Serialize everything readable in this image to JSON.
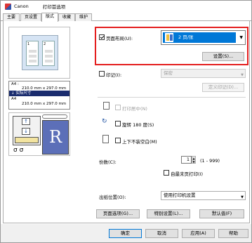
{
  "window": {
    "brand": "Canon",
    "title": "打印首选项"
  },
  "tabs": [
    "主要",
    "页设置",
    "版式",
    "收藏",
    "维护"
  ],
  "active_tab": "版式",
  "page_layout": {
    "checkbox_label": "页面布局(U):",
    "checked": true,
    "selected": "2 页/张",
    "settings_button": "设置(S)..."
  },
  "stamp": {
    "checkbox_label": "印记(I):",
    "checked": false,
    "combo_value": "保密",
    "define_button": "定义印记(D)..."
  },
  "print_from_center": {
    "label": "打印居中(N)",
    "checked": false
  },
  "rotate_180": {
    "label": "旋转 180 度(S)",
    "checked": false
  },
  "no_margin_top_bottom": {
    "label": "上下不装空白(M)",
    "checked": false
  },
  "copies": {
    "label": "份数(C):",
    "value": "1",
    "range": "(1 - 999)",
    "print_from_last": {
      "label": "自最末页打印(I)",
      "checked": false
    }
  },
  "output_tray": {
    "label": "出纸位置(O):",
    "value": "使用打印机设置"
  },
  "preview_info": {
    "paper_a4_line1": "A4 :",
    "size_line1": "210.0 mm x 297.0 mm",
    "fit_label": "实际尺寸",
    "paper_a4_line2": "A4",
    "size_line2": "210.0 mm x 297.0 mm",
    "page_numbers": [
      "1",
      "2"
    ]
  },
  "panel_buttons": {
    "page_options": "页面选项(G)...",
    "special": "特别设置(L)...",
    "defaults": "默认值(F)"
  },
  "footer_buttons": {
    "ok": "确定",
    "cancel": "取消",
    "apply": "应用(A)",
    "help": "帮助"
  },
  "colors": {
    "highlight_blue": "#0078d7",
    "red_frame": "#e41e1e",
    "paper_info_highlight": "#1a2c6e"
  }
}
